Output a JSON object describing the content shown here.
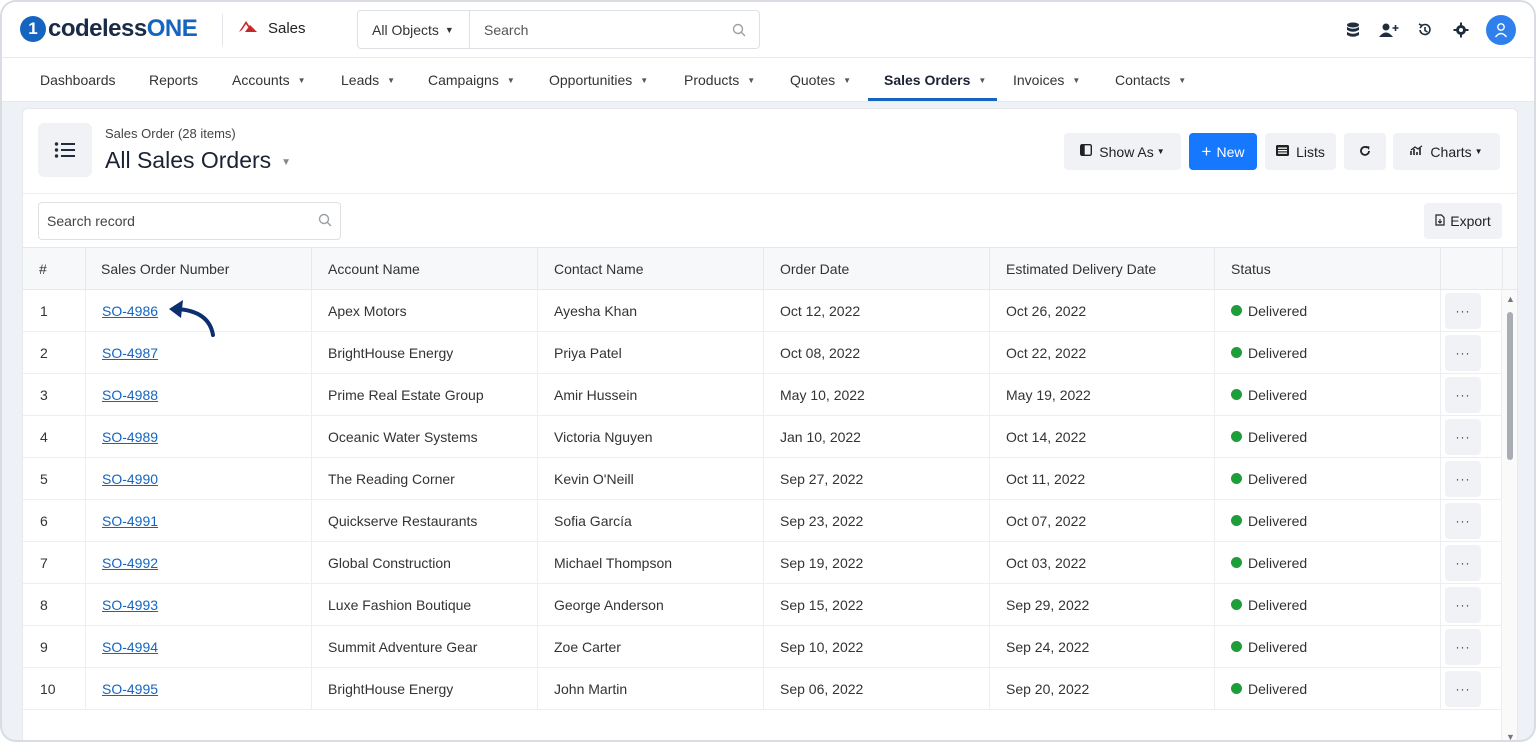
{
  "brand": {
    "logo_mark": "1",
    "logo_text_a": "codeless",
    "logo_text_b": "ONE"
  },
  "app": {
    "name": "Sales"
  },
  "global_search": {
    "object_filter": "All Objects",
    "placeholder": "Search"
  },
  "top_icons": [
    "database-icon",
    "add-user-icon",
    "history-icon",
    "settings-icon",
    "user-avatar-icon"
  ],
  "nav": {
    "items": [
      {
        "label": "Dashboards",
        "dropdown": false
      },
      {
        "label": "Reports",
        "dropdown": false
      },
      {
        "label": "Accounts",
        "dropdown": true
      },
      {
        "label": "Leads",
        "dropdown": true
      },
      {
        "label": "Campaigns",
        "dropdown": true
      },
      {
        "label": "Opportunities",
        "dropdown": true
      },
      {
        "label": "Products",
        "dropdown": true
      },
      {
        "label": "Quotes",
        "dropdown": true
      },
      {
        "label": "Sales Orders",
        "dropdown": true,
        "active": true
      },
      {
        "label": "Invoices",
        "dropdown": true
      },
      {
        "label": "Contacts",
        "dropdown": true
      }
    ]
  },
  "header": {
    "subtitle": "Sales Order (28 items)",
    "title": "All Sales Orders",
    "buttons": {
      "show_as": "Show As",
      "new": "New",
      "lists": "Lists",
      "charts": "Charts"
    }
  },
  "record_search": {
    "placeholder": "Search record"
  },
  "export": {
    "label": "Export"
  },
  "table": {
    "columns": [
      "#",
      "Sales Order Number",
      "Account Name",
      "Contact Name",
      "Order Date",
      "Estimated Delivery Date",
      "Status"
    ],
    "rows": [
      {
        "n": "1",
        "so": "SO-4986",
        "account": "Apex Motors",
        "contact": "Ayesha Khan",
        "order_date": "Oct 12, 2022",
        "delivery": "Oct 26, 2022",
        "status": "Delivered"
      },
      {
        "n": "2",
        "so": "SO-4987",
        "account": "BrightHouse Energy",
        "contact": "Priya Patel",
        "order_date": "Oct 08, 2022",
        "delivery": "Oct 22, 2022",
        "status": "Delivered"
      },
      {
        "n": "3",
        "so": "SO-4988",
        "account": "Prime Real Estate Group",
        "contact": "Amir Hussein",
        "order_date": "May 10, 2022",
        "delivery": "May 19, 2022",
        "status": "Delivered"
      },
      {
        "n": "4",
        "so": "SO-4989",
        "account": "Oceanic Water Systems",
        "contact": "Victoria Nguyen",
        "order_date": "Jan 10, 2022",
        "delivery": "Oct 14, 2022",
        "status": "Delivered"
      },
      {
        "n": "5",
        "so": "SO-4990",
        "account": "The Reading Corner",
        "contact": "Kevin O'Neill",
        "order_date": "Sep 27, 2022",
        "delivery": "Oct 11, 2022",
        "status": "Delivered"
      },
      {
        "n": "6",
        "so": "SO-4991",
        "account": "Quickserve Restaurants",
        "contact": "Sofia García",
        "order_date": "Sep 23, 2022",
        "delivery": "Oct 07, 2022",
        "status": "Delivered"
      },
      {
        "n": "7",
        "so": "SO-4992",
        "account": "Global Construction",
        "contact": "Michael Thompson",
        "order_date": "Sep 19, 2022",
        "delivery": "Oct 03, 2022",
        "status": "Delivered"
      },
      {
        "n": "8",
        "so": "SO-4993",
        "account": "Luxe Fashion Boutique",
        "contact": "George Anderson",
        "order_date": "Sep 15, 2022",
        "delivery": "Sep 29, 2022",
        "status": "Delivered"
      },
      {
        "n": "9",
        "so": "SO-4994",
        "account": "Summit Adventure Gear",
        "contact": "Zoe Carter",
        "order_date": "Sep 10, 2022",
        "delivery": "Sep 24, 2022",
        "status": "Delivered"
      },
      {
        "n": "10",
        "so": "SO-4995",
        "account": "BrightHouse Energy",
        "contact": "John Martin",
        "order_date": "Sep 06, 2022",
        "delivery": "Sep 20, 2022",
        "status": "Delivered"
      }
    ],
    "row_action_label": "···"
  },
  "colors": {
    "accent": "#1677ff",
    "link": "#1565c0",
    "status_delivered": "#1e9e3a"
  }
}
